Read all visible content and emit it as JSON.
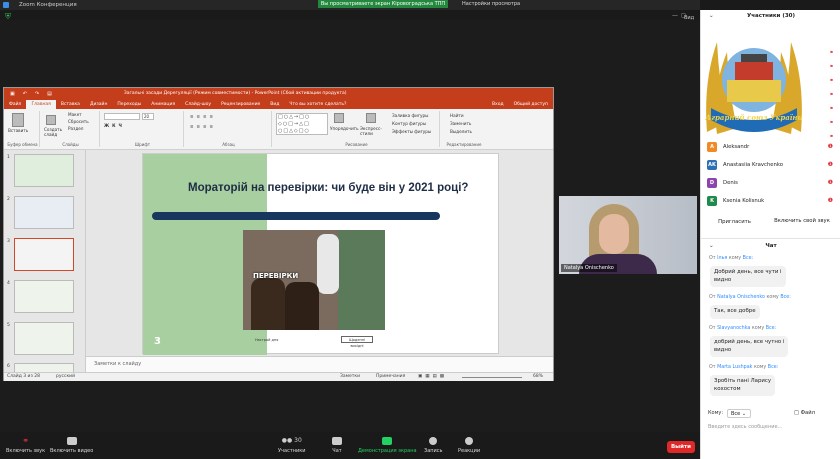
{
  "zoom": {
    "window_title": "Zoom Конференция",
    "banner": "Вы просматриваете экран Кіровоградська ТПП",
    "view_options": "Настройки просмотра",
    "view_label": "Вид"
  },
  "ppt": {
    "title": "Загальні засади Дерегуляції (Режим совместимости) - PowerPoint (Сбой активации продукта)",
    "tabs": [
      "Файл",
      "Главная",
      "Вставка",
      "Дизайн",
      "Переходы",
      "Анимация",
      "Слайд-шоу",
      "Рецензирование",
      "Вид",
      "Что вы хотите сделать?"
    ],
    "right_tabs": [
      "Вход",
      "Общий доступ"
    ],
    "ribbon": {
      "paste": "Вставить",
      "clipboard": "Буфер обмена",
      "layout": "Макет",
      "reset": "Сбросить",
      "section": "Раздел",
      "create_slide": "Создать слайд",
      "slides": "Слайды",
      "font": "Шрифт",
      "paragraph": "Абзац",
      "arrange": "Упорядочить",
      "express_styles": "Экспресс-стили",
      "fill": "Заливка фигуры",
      "outline": "Контур фигуры",
      "effects": "Эффекты фигуры",
      "drawing": "Рисование",
      "find": "Найти",
      "replace": "Заменить",
      "select": "Выделить",
      "editing": "Редактирование",
      "font_size": "20"
    },
    "thumb_numbers": [
      "1",
      "2",
      "3",
      "4",
      "5",
      "6"
    ],
    "slide": {
      "title": "Мораторій на перевірки: чи буде він у 2021 році?",
      "image_caption": "ПЕРЕВІРКИ",
      "source": "Настрой дня",
      "link": "Щоденні вихідні",
      "number": "3"
    },
    "notes": "Заметки к слайду",
    "status": {
      "slide_of": "Слайд 3 из 28",
      "lang": "русский",
      "notes_btn": "Заметки",
      "comments_btn": "Примечания",
      "zoom": "68%"
    }
  },
  "webcam": {
    "name": "Natalya  Onischenko"
  },
  "panel": {
    "participants_title": "Участники (30)",
    "participants": [
      {
        "initial": "A",
        "name": "Aleksandr",
        "color": "#f08a24"
      },
      {
        "initial": "AK",
        "name": "Anastasiia Kravchenko",
        "color": "#2f6fb3"
      },
      {
        "initial": "D",
        "name": "Denis",
        "color": "#8e44ad"
      },
      {
        "initial": "K",
        "name": "Ksenia Kolisnuk",
        "color": "#1e8a4c"
      }
    ],
    "logo_text": "Аграрний союз України",
    "invite": "Пригласить",
    "unmute_all": "Включить свой звук",
    "chat_title": "Чат",
    "messages": [
      {
        "from": "Ілья",
        "to": "кому",
        "all": "Все:",
        "text_lines": [
          "Добрий день, все чути і",
          "видно"
        ]
      },
      {
        "from": "Natalya  Onischenko",
        "to": "кому",
        "all": "Все:",
        "text_lines": [
          "Так, все добре"
        ]
      },
      {
        "from": "Slavyanochka",
        "to": "кому",
        "all": "Все:",
        "text_lines": [
          "добрий день, все чутно і",
          "видно"
        ]
      },
      {
        "from": "Marta Lushpak",
        "to": "кому",
        "all": "Все:",
        "text_lines": [
          "Зробіть пані Ларису",
          "кохостом"
        ]
      }
    ],
    "from_prefix": "От",
    "to_label": "Кому:",
    "to_value": "Все",
    "file_btn": "Файл",
    "input_placeholder": "Введите здесь сообщение..."
  },
  "toolbar": {
    "audio": "Включить звук",
    "video": "Включить видео",
    "participants": "Участники",
    "participants_count": "30",
    "chat": "Чат",
    "share": "Демонстрация экрана",
    "record": "Запись",
    "reactions": "Реакции",
    "leave": "Выйти"
  },
  "colors": {
    "ppt_accent": "#c43e1c",
    "share_green": "#23883d",
    "zoom_blue": "#2d8cff",
    "leave_red": "#e02828"
  }
}
